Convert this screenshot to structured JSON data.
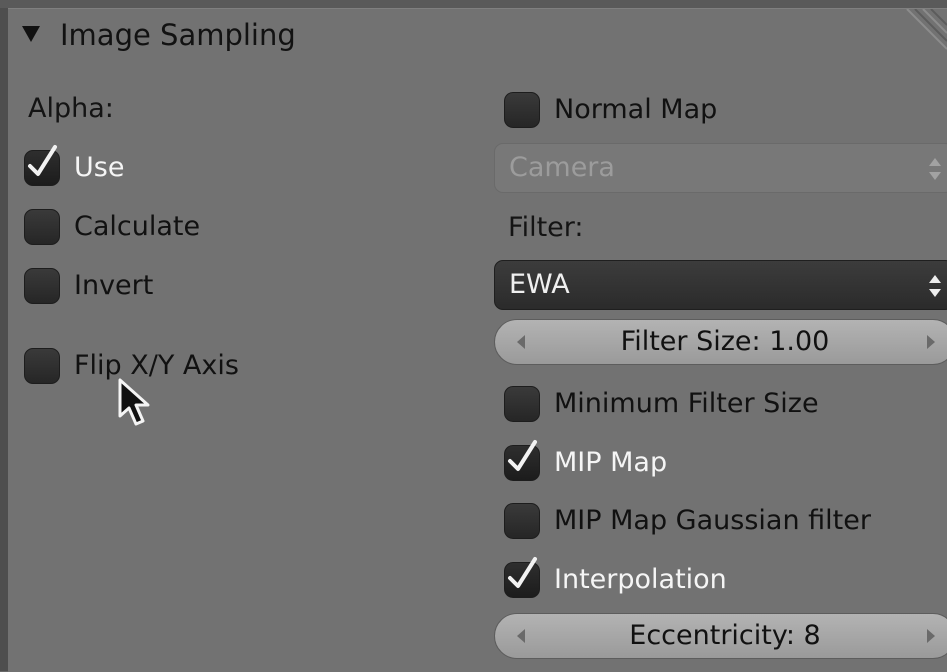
{
  "panel": {
    "title": "Image Sampling"
  },
  "alpha": {
    "heading": "Alpha:",
    "use": {
      "label": "Use",
      "checked": true
    },
    "calculate": {
      "label": "Calculate",
      "checked": false
    },
    "invert": {
      "label": "Invert",
      "checked": false
    }
  },
  "flip_axis": {
    "label": "Flip X/Y Axis",
    "checked": false
  },
  "normal_map": {
    "label": "Normal Map",
    "checked": false,
    "space_dropdown": {
      "value": "Camera",
      "enabled": false
    }
  },
  "filter": {
    "heading": "Filter:",
    "type_dropdown": {
      "value": "EWA"
    },
    "filter_size": {
      "label": "Filter Size: 1.00"
    },
    "minimum_filter_size": {
      "label": "Minimum Filter Size",
      "checked": false
    },
    "mip_map": {
      "label": "MIP Map",
      "checked": true
    },
    "mip_map_gaussian": {
      "label": "MIP Map Gaussian filter",
      "checked": false
    },
    "interpolation": {
      "label": "Interpolation",
      "checked": true
    },
    "eccentricity": {
      "label": "Eccentricity: 8"
    }
  },
  "colors": {
    "panel_bg": "#727272",
    "checkbox_bg": "#2b2b2b",
    "slider_bg": "#a8a8a8",
    "active_dropdown_bg": "#333333"
  }
}
